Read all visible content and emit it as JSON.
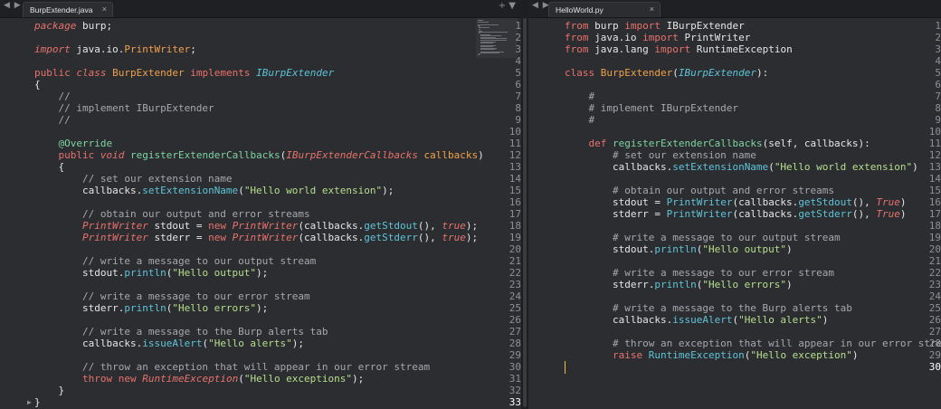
{
  "left_tab": {
    "title": "BurpExtender.java",
    "close": "×",
    "nav": "◀ ▶",
    "actions": "+ ▼"
  },
  "right_tab": {
    "title": "HelloWorld.py",
    "close": "×",
    "nav": "◀ ▶"
  },
  "left_active_line": 33,
  "right_active_line": 30,
  "colors": {
    "background": "#2b2d31",
    "keyword": "#e8726c",
    "class": "#f0a14b",
    "interface": "#5ec4d8",
    "string": "#b7df8c",
    "comment": "#a6a8ad",
    "cursor": "#f0c040"
  },
  "left_lines": [
    [
      [
        "kwi",
        "package"
      ],
      [
        "plain",
        " burp;"
      ]
    ],
    [],
    [
      [
        "kwi",
        "import"
      ],
      [
        "plain",
        " java.io."
      ],
      [
        "cls",
        "PrintWriter"
      ],
      [
        "plain",
        ";"
      ]
    ],
    [],
    [
      [
        "kw",
        "public"
      ],
      [
        "plain",
        " "
      ],
      [
        "kwi",
        "class"
      ],
      [
        "plain",
        " "
      ],
      [
        "cls",
        "BurpExtender"
      ],
      [
        "plain",
        " "
      ],
      [
        "kw",
        "implements"
      ],
      [
        "plain",
        " "
      ],
      [
        "iface",
        "IBurpExtender"
      ]
    ],
    [
      [
        "plain",
        "{"
      ]
    ],
    [
      [
        "com",
        "    //"
      ]
    ],
    [
      [
        "com",
        "    // implement IBurpExtender"
      ]
    ],
    [
      [
        "com",
        "    //"
      ]
    ],
    [],
    [
      [
        "plain",
        "    "
      ],
      [
        "ann",
        "@Override"
      ]
    ],
    [
      [
        "plain",
        "    "
      ],
      [
        "kw",
        "public"
      ],
      [
        "plain",
        " "
      ],
      [
        "kwi",
        "void"
      ],
      [
        "plain",
        " "
      ],
      [
        "fn",
        "registerExtenderCallbacks"
      ],
      [
        "plain",
        "("
      ],
      [
        "type",
        "IBurpExtenderCallbacks"
      ],
      [
        "plain",
        " "
      ],
      [
        "param",
        "callbacks"
      ],
      [
        "plain",
        ")"
      ]
    ],
    [
      [
        "plain",
        "    {"
      ]
    ],
    [
      [
        "com",
        "        // set our extension name"
      ]
    ],
    [
      [
        "plain",
        "        callbacks."
      ],
      [
        "method",
        "setExtensionName"
      ],
      [
        "plain",
        "("
      ],
      [
        "str",
        "\"Hello world extension\""
      ],
      [
        "plain",
        ");"
      ]
    ],
    [],
    [
      [
        "com",
        "        // obtain our output and error streams"
      ]
    ],
    [
      [
        "plain",
        "        "
      ],
      [
        "type",
        "PrintWriter"
      ],
      [
        "plain",
        " stdout = "
      ],
      [
        "kw",
        "new"
      ],
      [
        "plain",
        " "
      ],
      [
        "type",
        "PrintWriter"
      ],
      [
        "plain",
        "(callbacks."
      ],
      [
        "method",
        "getStdout"
      ],
      [
        "plain",
        "(), "
      ],
      [
        "bool",
        "true"
      ],
      [
        "plain",
        ");"
      ]
    ],
    [
      [
        "plain",
        "        "
      ],
      [
        "type",
        "PrintWriter"
      ],
      [
        "plain",
        " stderr = "
      ],
      [
        "kw",
        "new"
      ],
      [
        "plain",
        " "
      ],
      [
        "type",
        "PrintWriter"
      ],
      [
        "plain",
        "(callbacks."
      ],
      [
        "method",
        "getStderr"
      ],
      [
        "plain",
        "(), "
      ],
      [
        "bool",
        "true"
      ],
      [
        "plain",
        ");"
      ]
    ],
    [],
    [
      [
        "com",
        "        // write a message to our output stream"
      ]
    ],
    [
      [
        "plain",
        "        stdout."
      ],
      [
        "method",
        "println"
      ],
      [
        "plain",
        "("
      ],
      [
        "str",
        "\"Hello output\""
      ],
      [
        "plain",
        ");"
      ]
    ],
    [],
    [
      [
        "com",
        "        // write a message to our error stream"
      ]
    ],
    [
      [
        "plain",
        "        stderr."
      ],
      [
        "method",
        "println"
      ],
      [
        "plain",
        "("
      ],
      [
        "str",
        "\"Hello errors\""
      ],
      [
        "plain",
        ");"
      ]
    ],
    [],
    [
      [
        "com",
        "        // write a message to the Burp alerts tab"
      ]
    ],
    [
      [
        "plain",
        "        callbacks."
      ],
      [
        "method",
        "issueAlert"
      ],
      [
        "plain",
        "("
      ],
      [
        "str",
        "\"Hello alerts\""
      ],
      [
        "plain",
        ");"
      ]
    ],
    [],
    [
      [
        "com",
        "        // throw an exception that will appear in our error stream"
      ]
    ],
    [
      [
        "plain",
        "        "
      ],
      [
        "kw",
        "throw"
      ],
      [
        "plain",
        " "
      ],
      [
        "kw",
        "new"
      ],
      [
        "plain",
        " "
      ],
      [
        "type",
        "RuntimeException"
      ],
      [
        "plain",
        "("
      ],
      [
        "str",
        "\"Hello exceptions\""
      ],
      [
        "plain",
        ");"
      ]
    ],
    [
      [
        "plain",
        "    }"
      ]
    ],
    [
      [
        "plain",
        "}"
      ]
    ]
  ],
  "right_lines": [
    [
      [
        "kw",
        "from"
      ],
      [
        "plain",
        " burp "
      ],
      [
        "kw",
        "import"
      ],
      [
        "plain",
        " IBurpExtender"
      ]
    ],
    [
      [
        "kw",
        "from"
      ],
      [
        "plain",
        " java.io "
      ],
      [
        "kw",
        "import"
      ],
      [
        "plain",
        " PrintWriter"
      ]
    ],
    [
      [
        "kw",
        "from"
      ],
      [
        "plain",
        " java.lang "
      ],
      [
        "kw",
        "import"
      ],
      [
        "plain",
        " RuntimeException"
      ]
    ],
    [],
    [
      [
        "kw",
        "class"
      ],
      [
        "plain",
        " "
      ],
      [
        "cls",
        "BurpExtender"
      ],
      [
        "plain",
        "("
      ],
      [
        "iface",
        "IBurpExtender"
      ],
      [
        "plain",
        "):"
      ]
    ],
    [],
    [
      [
        "com",
        "    #"
      ]
    ],
    [
      [
        "com",
        "    # implement IBurpExtender"
      ]
    ],
    [
      [
        "com",
        "    #"
      ]
    ],
    [],
    [
      [
        "plain",
        "    "
      ],
      [
        "kw",
        "def"
      ],
      [
        "plain",
        " "
      ],
      [
        "fn",
        "registerExtenderCallbacks"
      ],
      [
        "plain",
        "(self, callbacks):"
      ]
    ],
    [
      [
        "com",
        "        # set our extension name"
      ]
    ],
    [
      [
        "plain",
        "        callbacks."
      ],
      [
        "method",
        "setExtensionName"
      ],
      [
        "plain",
        "("
      ],
      [
        "str",
        "\"Hello world extension\""
      ],
      [
        "plain",
        ")"
      ]
    ],
    [],
    [
      [
        "com",
        "        # obtain our output and error streams"
      ]
    ],
    [
      [
        "plain",
        "        stdout = "
      ],
      [
        "method",
        "PrintWriter"
      ],
      [
        "plain",
        "(callbacks."
      ],
      [
        "method",
        "getStdout"
      ],
      [
        "plain",
        "(), "
      ],
      [
        "bool",
        "True"
      ],
      [
        "plain",
        ")"
      ]
    ],
    [
      [
        "plain",
        "        stderr = "
      ],
      [
        "method",
        "PrintWriter"
      ],
      [
        "plain",
        "(callbacks."
      ],
      [
        "method",
        "getStderr"
      ],
      [
        "plain",
        "(), "
      ],
      [
        "bool",
        "True"
      ],
      [
        "plain",
        ")"
      ]
    ],
    [],
    [
      [
        "com",
        "        # write a message to our output stream"
      ]
    ],
    [
      [
        "plain",
        "        stdout."
      ],
      [
        "method",
        "println"
      ],
      [
        "plain",
        "("
      ],
      [
        "str",
        "\"Hello output\""
      ],
      [
        "plain",
        ")"
      ]
    ],
    [],
    [
      [
        "com",
        "        # write a message to our error stream"
      ]
    ],
    [
      [
        "plain",
        "        stderr."
      ],
      [
        "method",
        "println"
      ],
      [
        "plain",
        "("
      ],
      [
        "str",
        "\"Hello errors\""
      ],
      [
        "plain",
        ")"
      ]
    ],
    [],
    [
      [
        "com",
        "        # write a message to the Burp alerts tab"
      ]
    ],
    [
      [
        "plain",
        "        callbacks."
      ],
      [
        "method",
        "issueAlert"
      ],
      [
        "plain",
        "("
      ],
      [
        "str",
        "\"Hello alerts\""
      ],
      [
        "plain",
        ")"
      ]
    ],
    [],
    [
      [
        "com",
        "        # throw an exception that will appear in our error stream"
      ]
    ],
    [
      [
        "plain",
        "        "
      ],
      [
        "kw",
        "raise"
      ],
      [
        "plain",
        " "
      ],
      [
        "method",
        "RuntimeException"
      ],
      [
        "plain",
        "("
      ],
      [
        "str",
        "\"Hello exception\""
      ],
      [
        "plain",
        ")"
      ]
    ],
    []
  ]
}
